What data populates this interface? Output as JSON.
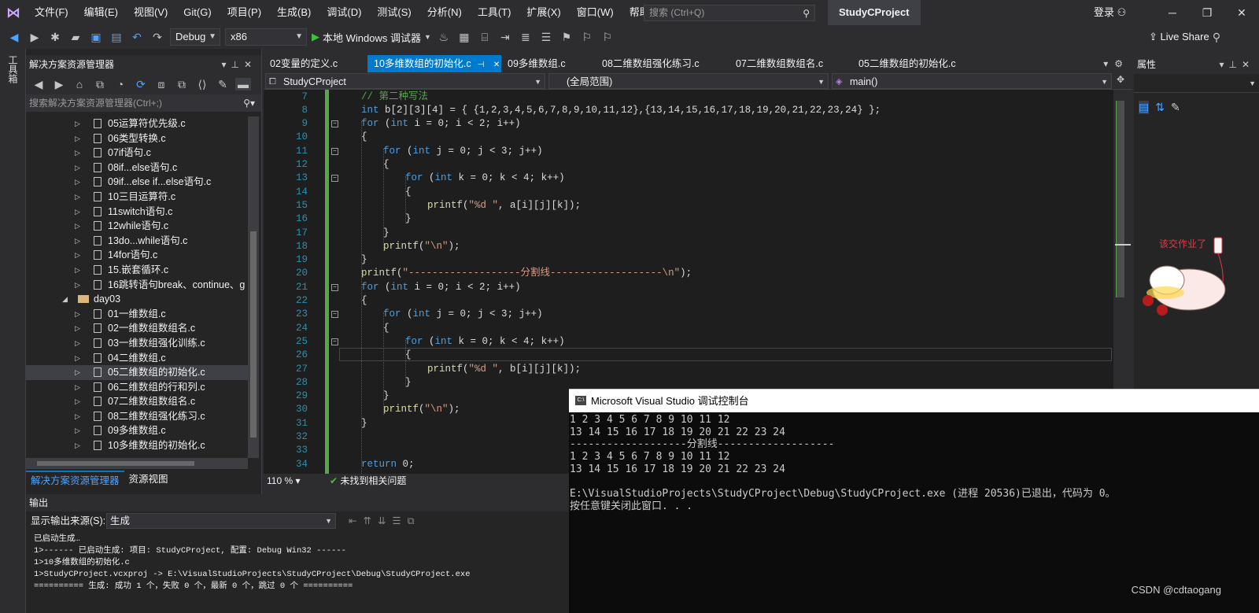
{
  "menubar": {
    "items": [
      "文件(F)",
      "编辑(E)",
      "视图(V)",
      "Git(G)",
      "项目(P)",
      "生成(B)",
      "调试(D)",
      "测试(S)",
      "分析(N)",
      "工具(T)",
      "扩展(X)",
      "窗口(W)",
      "帮助(H)"
    ],
    "search_placeholder": "搜索 (Ctrl+Q)",
    "project_title": "StudyCProject",
    "login": "登录"
  },
  "toolbar": {
    "config": "Debug",
    "platform": "x86",
    "run_label": "本地 Windows 调试器",
    "live_share": "Live Share"
  },
  "toolstrip": {
    "label": "工具箱"
  },
  "solution_explorer": {
    "title": "解决方案资源管理器",
    "search_placeholder": "搜索解决方案资源管理器(Ctrl+;)",
    "items": [
      {
        "label": "05运算符优先级.c",
        "kind": "file"
      },
      {
        "label": "06类型转换.c",
        "kind": "file"
      },
      {
        "label": "07if语句.c",
        "kind": "file"
      },
      {
        "label": "08if...else语句.c",
        "kind": "file"
      },
      {
        "label": "09if...else if...else语句.c",
        "kind": "file"
      },
      {
        "label": "10三目运算符.c",
        "kind": "file"
      },
      {
        "label": "11switch语句.c",
        "kind": "file"
      },
      {
        "label": "12while语句.c",
        "kind": "file"
      },
      {
        "label": "13do...while语句.c",
        "kind": "file"
      },
      {
        "label": "14for语句.c",
        "kind": "file"
      },
      {
        "label": "15.嵌套循环.c",
        "kind": "file"
      },
      {
        "label": "16跳转语句break、continue、g",
        "kind": "file"
      },
      {
        "label": "day03",
        "kind": "folder"
      },
      {
        "label": "01一维数组.c",
        "kind": "file"
      },
      {
        "label": "02一维数组数组名.c",
        "kind": "file"
      },
      {
        "label": "03一维数组强化训练.c",
        "kind": "file"
      },
      {
        "label": "04二维数组.c",
        "kind": "file"
      },
      {
        "label": "05二维数组的初始化.c",
        "kind": "file",
        "selected": true
      },
      {
        "label": "06二维数组的行和列.c",
        "kind": "file"
      },
      {
        "label": "07二维数组数组名.c",
        "kind": "file"
      },
      {
        "label": "08二维数组强化练习.c",
        "kind": "file"
      },
      {
        "label": "09多维数组.c",
        "kind": "file"
      },
      {
        "label": "10多维数组的初始化.c",
        "kind": "file"
      }
    ],
    "tabs": [
      "解决方案资源管理器",
      "资源视图"
    ]
  },
  "editor": {
    "tabs": [
      "02变量的定义.c",
      "10多维数组的初始化.c",
      "09多维数组.c",
      "08二维数组强化练习.c",
      "07二维数组数组名.c",
      "05二维数组的初始化.c"
    ],
    "active_tab": 1,
    "nav_project": "StudyCProject",
    "nav_scope": "(全局范围)",
    "nav_member": "main()",
    "zoom": "110 %",
    "issues": "未找到相关问题"
  },
  "properties": {
    "title": "属性",
    "sticker_text": "该交作业了"
  },
  "output": {
    "title": "输出",
    "source_label": "显示输出来源(S):",
    "source_value": "生成",
    "lines": [
      "已启动生成…",
      "1>------ 已启动生成: 项目: StudyCProject, 配置: Debug Win32 ------",
      "1>10多维数组的初始化.c",
      "1>StudyCProject.vcxproj -> E:\\VisualStudioProjects\\StudyCProject\\Debug\\StudyCProject.exe",
      "========== 生成: 成功 1 个，失败 0 个，最新 0 个，跳过 0 个 =========="
    ]
  },
  "console": {
    "title": "Microsoft Visual Studio 调试控制台",
    "lines": [
      "1 2 3 4 5 6 7 8 9 10 11 12",
      "13 14 15 16 17 18 19 20 21 22 23 24",
      "-------------------分割线-------------------",
      "1 2 3 4 5 6 7 8 9 10 11 12",
      "13 14 15 16 17 18 19 20 21 22 23 24",
      "",
      "E:\\VisualStudioProjects\\StudyCProject\\Debug\\StudyCProject.exe (进程 20536)已退出，代码为 0。",
      "按任意键关闭此窗口. . ."
    ],
    "watermark": "CSDN @cdtaogang"
  },
  "code_lines": [
    {
      "n": "7"
    },
    {
      "n": "8"
    },
    {
      "n": "9"
    },
    {
      "n": "10"
    },
    {
      "n": "11"
    },
    {
      "n": "12"
    },
    {
      "n": "13"
    },
    {
      "n": "14"
    },
    {
      "n": "15"
    },
    {
      "n": "16"
    },
    {
      "n": "17"
    },
    {
      "n": "18"
    },
    {
      "n": "19"
    },
    {
      "n": "20"
    },
    {
      "n": "21"
    },
    {
      "n": "22"
    },
    {
      "n": "23"
    },
    {
      "n": "24"
    },
    {
      "n": "25"
    },
    {
      "n": "26"
    },
    {
      "n": "27"
    },
    {
      "n": "28"
    },
    {
      "n": "29"
    },
    {
      "n": "30"
    },
    {
      "n": "31"
    },
    {
      "n": "32"
    },
    {
      "n": "33"
    },
    {
      "n": "34"
    }
  ],
  "code": {
    "l7": "// 第二种写法",
    "l8_kw": "int",
    "l8_rest": " b[2][3][4] = { {1,2,3,4,5,6,7,8,9,10,11,12},{13,14,15,16,17,18,19,20,21,22,23,24} };",
    "for": "for",
    "int": "int",
    "printf": "printf",
    "return": "return",
    "loop_i": " i = 0; i < 2; i++)",
    "loop_j": " j = 0; j < 3; j++)",
    "loop_k": " k = 0; k < 4; k++)",
    "print_a_fmt": "\"%d \"",
    "print_a_args": ", a[i][j][k]);",
    "print_b_args": ", b[i][j][k]);",
    "newline_str": "\"\\n\"",
    "divider_str": "\"-------------------分割线-------------------\\n\"",
    "return_val": " 0;"
  }
}
